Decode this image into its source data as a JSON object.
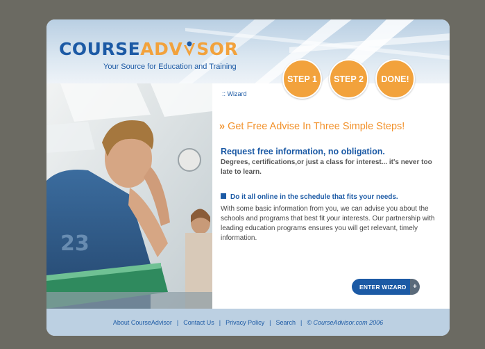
{
  "brand": {
    "logo_part1": "COURSE",
    "logo_part2": "ADV",
    "logo_part3": "SOR",
    "tagline": "Your Source for Education and Training",
    "primary_color": "#1c5aa5",
    "accent_color": "#f2a23c"
  },
  "steps": [
    "STEP 1",
    "STEP 2",
    "DONE!"
  ],
  "content": {
    "breadcrumb": ":: Wizard",
    "headline_arrow": "»",
    "headline": "Get Free Advise In Three Simple Steps!",
    "sub1_title": "Request free information, no obligation.",
    "sub1_body": "Degrees, certifications,or just a class for interest... it's never too late to learn.",
    "sub2_title": "Do it all online in the schedule that fits your needs.",
    "paragraph": "With some basic information from you, we can advise you about the schools and programs that best fit your interests. Our partnership with leading education programs ensures you will get relevant, timely information.",
    "enter_button": "ENTER WIZARD",
    "enter_button_icon": "+"
  },
  "footer": {
    "links": [
      "About CourseAdvisor",
      "Contact Us",
      "Privacy Policy",
      "Search"
    ],
    "separator": "|",
    "copyright": "© CourseAdvisor.com 2006"
  }
}
